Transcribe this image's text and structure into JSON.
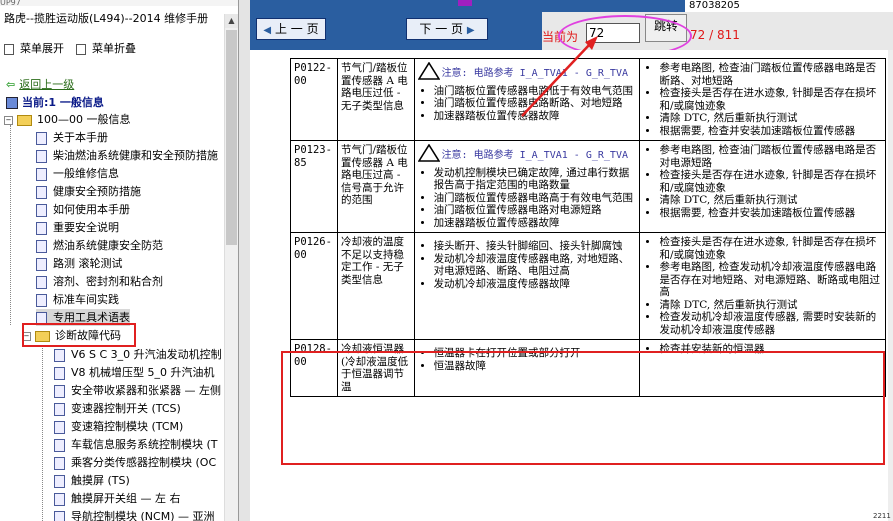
{
  "top_strip": "UP97",
  "manual_title": "路虎--揽胜运动版(L494)--2014 维修手册",
  "expand_all": "菜单展开",
  "collapse_all": "菜单折叠",
  "back_link": "返回上一级",
  "current_label": "当前:1 一般信息",
  "tree": {
    "root": "100—00 一般信息",
    "items": [
      "关于本手册",
      "柴油燃油系统健康和安全预防措施",
      "一般维修信息",
      "健康安全预防措施",
      "如何使用本手册",
      "重要安全说明",
      "燃油系统健康安全防范",
      "路测 滚轮测试",
      "溶剂、密封剂和粘合剂",
      "标准车间实践",
      "专用工具术语表"
    ],
    "folder": "诊断故障代码",
    "sub_items": [
      "V6 S C 3_0 升汽油发动机控制",
      "V8 机械增压型 5_0 升汽油机",
      "安全带收紧器和张紧器 — 左侧",
      "变速器控制开关 (TCS)",
      "变速箱控制模块 (TCM)",
      "车载信息服务系统控制模块 (T",
      "乘客分类传感器控制模块 (OC",
      "触摸屏 (TS)",
      "触摸屏开关组 — 左 右",
      "导航控制模块 (NCM) — 亚洲"
    ]
  },
  "toolbar": {
    "prev": "上 一 页",
    "next": "下 一 页",
    "page_label": "当前为",
    "page_value": "72",
    "go": "跳转",
    "page_count": "72 / 811",
    "corner_text": "87038205"
  },
  "rows": [
    {
      "code": "P0122-00",
      "desc": "节气门/踏板位置传感器 A 电路电压过低 - 无子类型信息",
      "note": "注意: 电路参考 I_A_TVA1 - G_R_TVA",
      "causes": [
        "油门踏板位置传感器电路低于有效电气范围",
        "油门踏板位置传感器电路断路、对地短路",
        "加速器踏板位置传感器故障"
      ],
      "fixes": [
        "参考电路图, 检查油门踏板位置传感器电路是否断路、对地短路",
        "检查接头是否存在进水迹象, 针脚是否存在损坏和/或腐蚀迹象",
        "清除 DTC, 然后重新执行测试",
        "根据需要, 检查并安装加速踏板位置传感器"
      ]
    },
    {
      "code": "P0123-85",
      "desc": "节气门/踏板位置传感器 A 电路电压过高 - 信号高于允许的范围",
      "note": "注意: 电路参考 I_A_TVA1 - G_R_TVA",
      "causes": [
        "发动机控制模块已确定故障, 通过串行数据报告高于指定范围的电路数量",
        "油门踏板位置传感器电路高于有效电气范围",
        "油门踏板位置传感器电路对电源短路",
        "加速器踏板位置传感器故障"
      ],
      "fixes": [
        "参考电路图, 检查油门踏板位置传感器电路是否对电源短路",
        "检查接头是否存在进水迹象, 针脚是否存在损坏和/或腐蚀迹象",
        "清除 DTC, 然后重新执行测试",
        "根据需要, 检查并安装加速踏板位置传感器"
      ]
    },
    {
      "code": "P0126-00",
      "desc": "冷却液的温度不足以支持稳定工作 - 无子类型信息",
      "note": "",
      "causes": [
        "接头断开、接头针脚缩回、接头针脚腐蚀",
        "发动机冷却液温度传感器电路, 对地短路、对电源短路、断路、电阻过高",
        "发动机冷却液温度传感器故障"
      ],
      "fixes": [
        "检查接头是否存在进水迹象, 针脚是否存在损坏和/或腐蚀迹象",
        "参考电路图, 检查发动机冷却液温度传感器电路是否存在对地短路、对电源短路、断路或电阻过高",
        "清除 DTC, 然后重新执行测试",
        "检查发动机冷却液温度传感器, 需要时安装新的发动机冷却液温度传感器"
      ]
    },
    {
      "code": "P0128-00",
      "desc": "冷却液恒温器 (冷却液温度低于恒温器调节温",
      "note": "",
      "causes": [
        "恒温器卡在打开位置或部分打开",
        "恒温器故障"
      ],
      "fixes": [
        "检查并安装新的恒温器"
      ]
    }
  ],
  "page_small": "2211"
}
